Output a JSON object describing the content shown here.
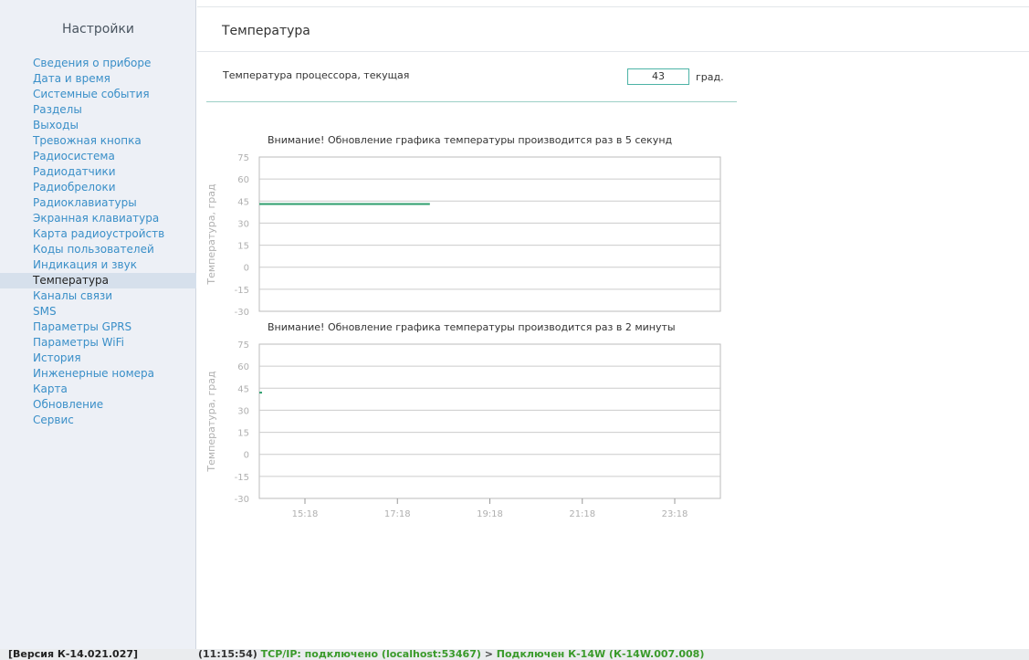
{
  "sidebar": {
    "title": "Настройки",
    "items": [
      {
        "label": "Сведения о приборе"
      },
      {
        "label": "Дата и время"
      },
      {
        "label": "Системные события"
      },
      {
        "label": "Разделы"
      },
      {
        "label": "Выходы"
      },
      {
        "label": "Тревожная кнопка"
      },
      {
        "label": "Радиосистема"
      },
      {
        "label": "Радиодатчики"
      },
      {
        "label": "Радиобрелоки"
      },
      {
        "label": "Радиоклавиатуры"
      },
      {
        "label": "Экранная клавиатура"
      },
      {
        "label": "Карта радиоустройств"
      },
      {
        "label": "Коды пользователей"
      },
      {
        "label": "Индикация и звук"
      },
      {
        "label": "Температура",
        "active": true
      },
      {
        "label": "Каналы связи"
      },
      {
        "label": "SMS"
      },
      {
        "label": "Параметры GPRS"
      },
      {
        "label": "Параметры WiFi"
      },
      {
        "label": "История"
      },
      {
        "label": "Инженерные номера"
      },
      {
        "label": "Карта"
      },
      {
        "label": "Обновление"
      },
      {
        "label": "Сервис"
      }
    ]
  },
  "page": {
    "title": "Температура",
    "cpu_label": "Температура процессора, текущая",
    "cpu_value": "43",
    "cpu_unit": "град."
  },
  "colors": {
    "line": "#2e9e6e",
    "grid": "#cccccc",
    "axis_text": "#b0b0b0",
    "link": "#3a8fc8"
  },
  "chart_data": [
    {
      "type": "line",
      "title": "Внимание! Обновление графика температуры производится раз в 5 секунд",
      "ylabel": "Температура, град",
      "yticks": [
        75,
        60,
        45,
        30,
        15,
        0,
        -15,
        -30
      ],
      "ylim": [
        -30,
        75
      ],
      "xticks": [],
      "series": [
        {
          "x": [
            0,
            0.37
          ],
          "y": [
            43,
            43
          ]
        }
      ]
    },
    {
      "type": "line",
      "title": "Внимание! Обновление графика температуры производится раз в 2 минуты",
      "ylabel": "Температура, град",
      "yticks": [
        75,
        60,
        45,
        30,
        15,
        0,
        -15,
        -30
      ],
      "ylim": [
        -30,
        75
      ],
      "xticks": [
        "15:18",
        "17:18",
        "19:18",
        "21:18",
        "23:18"
      ],
      "series": [
        {
          "x": [
            0,
            0.006
          ],
          "y": [
            42,
            42
          ]
        }
      ]
    }
  ],
  "status": {
    "version": "[Версия К-14.021.027]",
    "time": "(11:15:54)",
    "tcp": "TCP/IP: подключено (localhost:53467)",
    "arrow": ">",
    "device": "Подключен К-14W (К-14W.007.008)"
  }
}
